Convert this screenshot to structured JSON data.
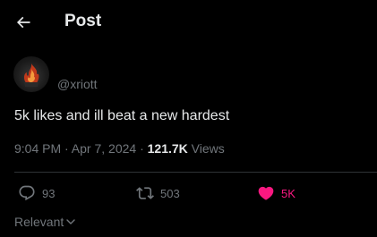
{
  "header": {
    "title": "Post"
  },
  "post": {
    "handle": "@xriott",
    "text": "5k likes and ill beat a new hardest",
    "time_date": "9:04 PM · Apr 7, 2024 · ",
    "views_count": "121.7K",
    "views_label": " Views"
  },
  "actions": {
    "replies": "93",
    "reposts": "503",
    "likes": "5K"
  },
  "sort": {
    "label": "Relevant"
  },
  "colors": {
    "background": "#000000",
    "primary_text": "#e7e9ea",
    "secondary_text": "#71767b",
    "like_pink": "#f91880",
    "divider": "#2f3336"
  },
  "icons": {
    "back": "arrow-left-icon",
    "reply": "reply-icon",
    "repost": "repost-icon",
    "like": "heart-filled-icon",
    "sort": "chevron-down-icon"
  }
}
